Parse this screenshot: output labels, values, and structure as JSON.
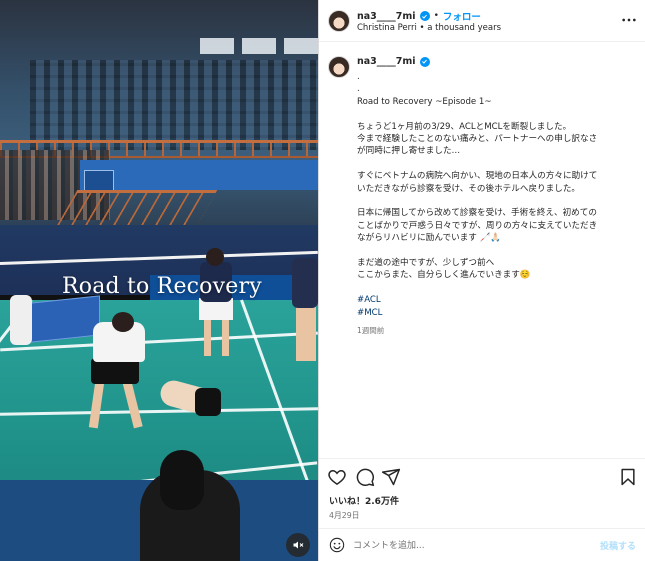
{
  "post": {
    "username": "na3____7mi",
    "follow_label": "フォロー",
    "audio": "Christina Perri • a thousand years",
    "video_overlay": "Road to Recovery",
    "caption": {
      "lines": [
        ".",
        ".",
        "Road to Recovery ~Episode 1~",
        "",
        "ちょうど1ヶ月前の3/29、ACLとMCLを断裂しました。",
        "今まで経験したことのない痛みと、パートナーへの申し訳なさ",
        "が同時に押し寄せました…",
        "",
        "すぐにベトナムの病院へ向かい、現地の日本人の方々に助けて",
        "いただきながら診察を受け、その後ホテルへ戻りました。",
        "",
        "日本に帰国してから改めて診察を受け、手術を終え、初めての",
        "ことばかりで戸惑う日々ですが、周りの方々に支えていただき",
        "ながらリハビリに励んでいます 🦯🙏🏻",
        "",
        "まだ道の途中ですが、少しずつ前へ",
        "ここからまた、自分らしく進んでいきます☺️",
        ""
      ],
      "hashtags": [
        "#ACL",
        "#MCL"
      ],
      "time_ago": "1週間前"
    },
    "likes": "いいね！2.6万件",
    "date": "4月29日",
    "comment_placeholder": "コメントを追加...",
    "post_button": "投稿する"
  },
  "icons": {
    "verified": "verified-badge-icon",
    "more": "more-options-icon",
    "like": "heart-icon",
    "comment": "comment-icon",
    "share": "send-icon",
    "save": "bookmark-icon",
    "emoji": "emoji-icon",
    "mute": "muted-speaker-icon"
  },
  "colors": {
    "accent": "#0095f6",
    "hashtag": "#00376b",
    "muted_text": "#737373",
    "post_disabled": "#b2dffc"
  }
}
